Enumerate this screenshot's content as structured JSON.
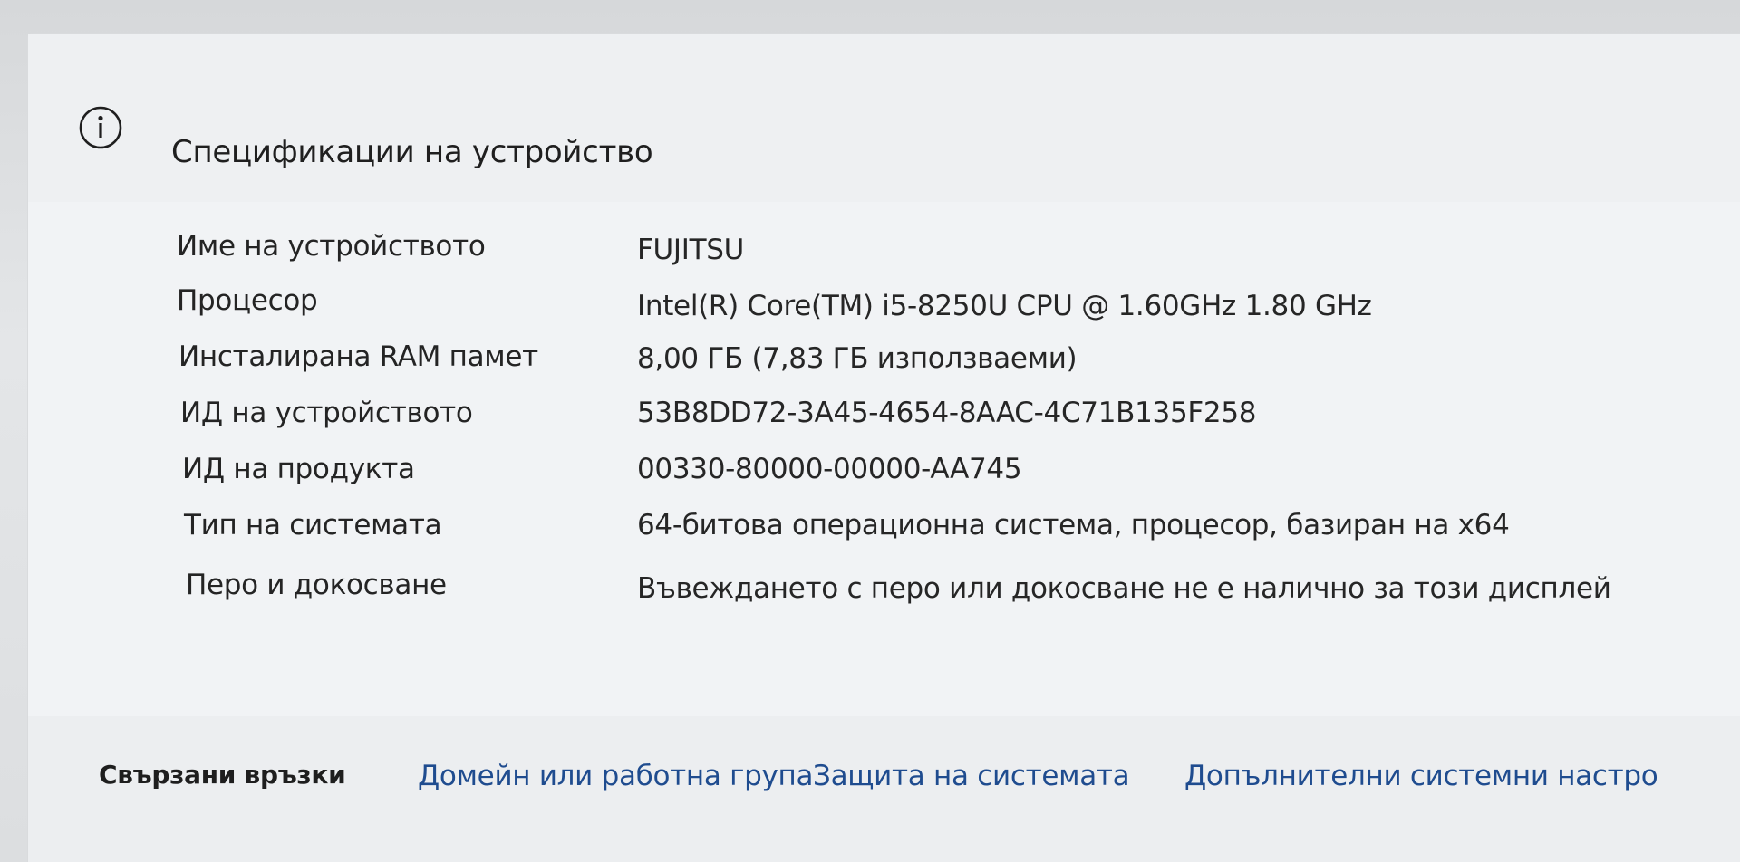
{
  "section": {
    "title": "Спецификации на устройство",
    "icon": "info-icon"
  },
  "specs": [
    {
      "label": "Име на устройството",
      "value": "FUJITSU"
    },
    {
      "label": "Процесор",
      "value": "Intel(R) Core(TM) i5-8250U CPU @ 1.60GHz   1.80 GHz"
    },
    {
      "label": "Инсталирана RAM памет",
      "value": "8,00 ГБ (7,83 ГБ използваеми)"
    },
    {
      "label": "ИД на устройството",
      "value": "53B8DD72-3A45-4654-8AAC-4C71B135F258"
    },
    {
      "label": "ИД на продукта",
      "value": "00330-80000-00000-AA745"
    },
    {
      "label": "Тип на системата",
      "value": "64-битова операционна система, процесор, базиран на x64"
    },
    {
      "label": "Перо и докосване",
      "value": "Въвеждането с перо или докосване не е налично за този дисплей"
    }
  ],
  "related_links": {
    "heading": "Свързани връзки",
    "links": [
      {
        "label": "Домейн или работна група"
      },
      {
        "label": "Защита на системата"
      },
      {
        "label": "Допълнителни системни настро"
      }
    ]
  },
  "colors": {
    "link": "#1f4c8f",
    "text": "#242424",
    "background": "#edeff1"
  }
}
